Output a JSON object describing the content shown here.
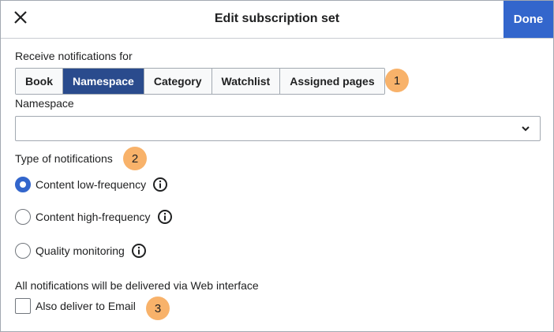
{
  "dialog": {
    "title": "Edit subscription set",
    "close_icon": "close-icon",
    "done_label": "Done",
    "accent_color": "#3366cc"
  },
  "receive": {
    "label": "Receive notifications for",
    "options": [
      "Book",
      "Namespace",
      "Category",
      "Watchlist",
      "Assigned pages"
    ],
    "selected": "Namespace",
    "badge": "1"
  },
  "namespace": {
    "label": "Namespace",
    "value": "",
    "icon": "chevron-down-icon"
  },
  "type": {
    "label": "Type of notifications",
    "badge": "2",
    "options": [
      {
        "label": "Content low-frequency",
        "checked": true,
        "info_icon": "info-icon"
      },
      {
        "label": "Content high-frequency",
        "checked": false,
        "info_icon": "info-icon"
      },
      {
        "label": "Quality monitoring",
        "checked": false,
        "info_icon": "info-icon"
      }
    ]
  },
  "delivery": {
    "note": "All notifications will be delivered via Web interface",
    "email_label": "Also deliver to Email",
    "email_checked": false,
    "badge": "3"
  },
  "colors": {
    "badge": "#f8b26a",
    "active_segment": "#2a4b8d"
  }
}
